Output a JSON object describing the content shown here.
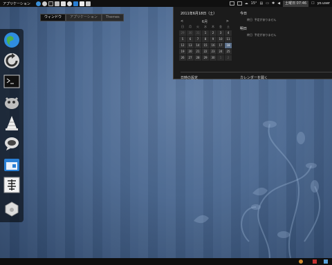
{
  "topbar": {
    "apps_label": "アプリケーション",
    "weather": "15°",
    "clock": "土曜日 07:46",
    "user": "yo.user"
  },
  "workspace_tabs": [
    "ウィンドウ",
    "アプリケーション",
    "Themes"
  ],
  "calendar": {
    "date_heading": "2011年6月18日（土）",
    "month": "6月",
    "weekday_headers": [
      "日",
      "月",
      "火",
      "水",
      "木",
      "金",
      "土"
    ],
    "weeks": [
      [
        "29",
        "30",
        "31",
        "1",
        "2",
        "3",
        "4"
      ],
      [
        "5",
        "6",
        "7",
        "8",
        "9",
        "10",
        "11"
      ],
      [
        "12",
        "13",
        "14",
        "15",
        "16",
        "17",
        "18"
      ],
      [
        "19",
        "20",
        "21",
        "22",
        "23",
        "24",
        "25"
      ],
      [
        "26",
        "27",
        "28",
        "29",
        "30",
        "1",
        "2"
      ]
    ],
    "today_day": "18",
    "settings_label": "日時の設定",
    "today_heading": "今日",
    "today_event_time": "終日",
    "today_event_text": "予定がありません",
    "tomorrow_heading": "明日",
    "tomorrow_event_time": "終日",
    "tomorrow_event_text": "予定がありません",
    "open_calendar_label": "カレンダーを開く"
  },
  "dock_icons": [
    "web-browser-icon",
    "update-icon",
    "terminal-icon",
    "gimp-icon",
    "vlc-icon",
    "chat-icon",
    "calendar-app-icon",
    "shrink-icon",
    "disk-icon"
  ],
  "colors": {
    "panel": "#101010",
    "desktop": "#3a5478",
    "today": "#5a6e88"
  }
}
